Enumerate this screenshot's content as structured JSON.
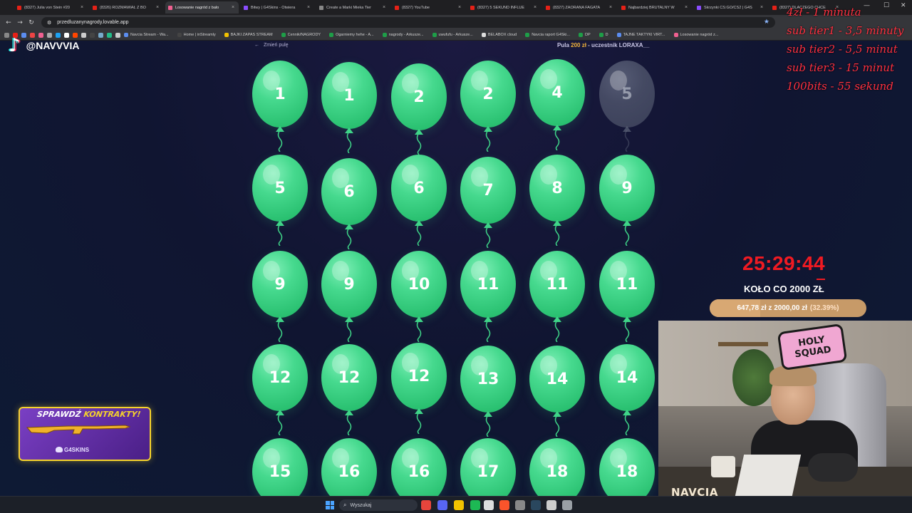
{
  "browser": {
    "tabs": [
      {
        "title": "(8327) Julia von Stein #20",
        "fav": "#e62117",
        "active": false
      },
      {
        "title": "(8326) ROZMAWIAŁ Z BO",
        "fav": "#e62117",
        "active": false
      },
      {
        "title": "Losowanie nagród z balo",
        "fav": "#f06090",
        "active": true
      },
      {
        "title": "Bitwy | G4Skins - Otwiera",
        "fav": "#8a4dff",
        "active": false
      },
      {
        "title": "Create a Marki Mieka Tier",
        "fav": "#888888",
        "active": false
      },
      {
        "title": "(8327) YouTube",
        "fav": "#e62117",
        "active": false
      },
      {
        "title": "(8327) 5 SEKUND INFLUE",
        "fav": "#e62117",
        "active": false
      },
      {
        "title": "(8327) ZAORANA FAGATA",
        "fav": "#e62117",
        "active": false
      },
      {
        "title": "Najbardziej BRUTALNY W",
        "fav": "#e62117",
        "active": false
      },
      {
        "title": "Skrzynki CS:GO/CS2 | G4S",
        "fav": "#8a4dff",
        "active": false
      },
      {
        "title": "(8327) DLACZEGO CHCE",
        "fav": "#e62117",
        "active": false
      }
    ],
    "window_controls": [
      "—",
      "☐",
      "✕"
    ],
    "url": "przedluzanynagrody.lovable.app",
    "bookmarks": [
      {
        "label": "Navcia Stream - Wa...",
        "color": "#5b8def"
      },
      {
        "label": "Home | inStreamly",
        "color": "#444444"
      },
      {
        "label": "BAJKI ZAPAS STREAM",
        "color": "#f2c200"
      },
      {
        "label": "Cennik/NAGRODY",
        "color": "#1e9e48"
      },
      {
        "label": "Ogarniemy hehe - A...",
        "color": "#1e9e48"
      },
      {
        "label": "nagrody - Arkusze...",
        "color": "#1e9e48"
      },
      {
        "label": "uwufufu - Arkusze...",
        "color": "#1e9e48"
      },
      {
        "label": "BELABOX cloud",
        "color": "#dddddd"
      },
      {
        "label": "Navcia raport G4Ski...",
        "color": "#1e9e48"
      },
      {
        "label": "DP",
        "color": "#1e9e48"
      },
      {
        "label": "D",
        "color": "#1e9e48"
      },
      {
        "label": "TAJNE TAKTYKI VIRT...",
        "color": "#5b8def"
      },
      {
        "label": "Losowanie nagród z...",
        "color": "#f06090"
      }
    ]
  },
  "page": {
    "back_label": "Zmień pulę",
    "pool_prefix": "Pula",
    "pool_amount": "200 zł",
    "pool_suffix": "- uczestnik LORAXA__"
  },
  "balloons": [
    {
      "number": "1",
      "popped": false
    },
    {
      "number": "1",
      "popped": false
    },
    {
      "number": "2",
      "popped": false
    },
    {
      "number": "2",
      "popped": false
    },
    {
      "number": "4",
      "popped": false
    },
    {
      "number": "5",
      "popped": true
    },
    {
      "number": "5",
      "popped": false
    },
    {
      "number": "6",
      "popped": false
    },
    {
      "number": "6",
      "popped": false
    },
    {
      "number": "7",
      "popped": false
    },
    {
      "number": "8",
      "popped": false
    },
    {
      "number": "9",
      "popped": false
    },
    {
      "number": "9",
      "popped": false
    },
    {
      "number": "9",
      "popped": false
    },
    {
      "number": "10",
      "popped": false
    },
    {
      "number": "11",
      "popped": false
    },
    {
      "number": "11",
      "popped": false
    },
    {
      "number": "11",
      "popped": false
    },
    {
      "number": "12",
      "popped": false
    },
    {
      "number": "12",
      "popped": false
    },
    {
      "number": "12",
      "popped": false
    },
    {
      "number": "13",
      "popped": false
    },
    {
      "number": "14",
      "popped": false
    },
    {
      "number": "14",
      "popped": false
    },
    {
      "number": "15",
      "popped": false
    },
    {
      "number": "16",
      "popped": false
    },
    {
      "number": "16",
      "popped": false
    },
    {
      "number": "17",
      "popped": false
    },
    {
      "number": "18",
      "popped": false
    },
    {
      "number": "18",
      "popped": false
    }
  ],
  "overlay": {
    "tiktok_handle": "@NAVVVIA",
    "rates": [
      "4zł - 1 minuta",
      "sub tier1 - 3,5 minuty",
      "sub tier2 - 5,5 minut",
      "sub tier3 - 15 minut",
      "100bits - 55 sekund"
    ],
    "timer": "25:29:44",
    "wheel_label": "KOŁO CO 2000 ZŁ",
    "progress_text": "647,78 zł z 2000,00 zł",
    "progress_pct": "(32.39%)",
    "progress_fraction": 0.3239,
    "cam_sticker_top": "HOLY",
    "cam_sticker_bottom": "SQUAD",
    "cam_name": "NAVCIA",
    "promo_title_a": "SPRAWDŹ",
    "promo_title_b": "KONTRAKTY!",
    "promo_brand": "G4SKINS"
  },
  "taskbar": {
    "search_placeholder": "Wyszukaj",
    "apps": [
      {
        "name": "chrome-icon",
        "color": "#e8453c"
      },
      {
        "name": "discord-icon",
        "color": "#5865f2"
      },
      {
        "name": "files-icon",
        "color": "#f2c200"
      },
      {
        "name": "spotify-icon",
        "color": "#1db954"
      },
      {
        "name": "obs-icon",
        "color": "#dddddd"
      },
      {
        "name": "brave-icon",
        "color": "#fb542b"
      },
      {
        "name": "app-icon",
        "color": "#888888"
      },
      {
        "name": "steam-icon",
        "color": "#2a475e"
      },
      {
        "name": "terminal-icon",
        "color": "#cccccc"
      },
      {
        "name": "settings-icon",
        "color": "#9aa0a6"
      }
    ]
  }
}
